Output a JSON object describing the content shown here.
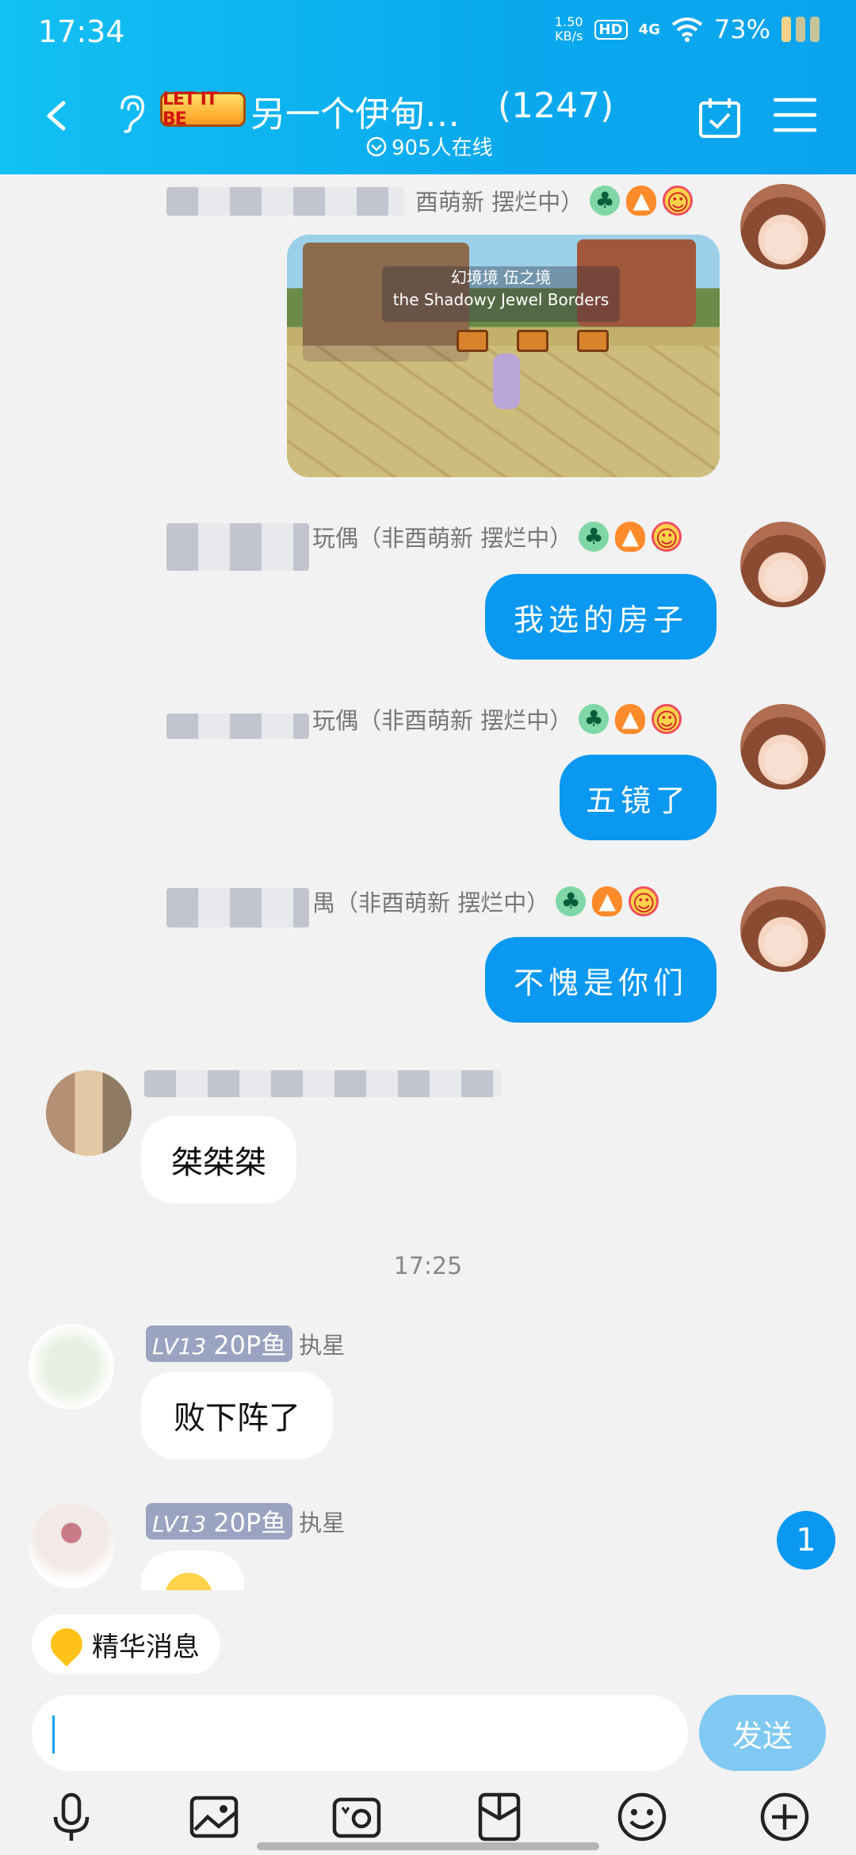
{
  "status_bar": {
    "time": "17:34",
    "speed": "1.50\nKB/s",
    "hd": "HD",
    "network": "4G",
    "battery_percent": "73%"
  },
  "header": {
    "back_icon": "chevron-left-icon",
    "ear_icon": "ear-icon",
    "logo_text": "LET IT BE",
    "title": "另一个伊甸…",
    "member_count": "(1247)",
    "online_text": "905人在线",
    "calendar_icon": "calendar-check-icon",
    "menu_icon": "hamburger-menu-icon"
  },
  "messages": {
    "m1_sender_suffix": "酉萌新 摆烂中）",
    "m1_banner_title": "幻境境 伍之境",
    "m1_banner_sub": "the Shadowy Jewel Borders",
    "m2_sender_suffix": "玩偶（非酉萌新 摆烂中）",
    "m2_text": "我选的房子",
    "m3_sender_suffix": "玩偶（非酉萌新 摆烂中）",
    "m3_text": "五镜了",
    "m4_sender_suffix": "禺（非酉萌新 摆烂中）",
    "m4_text": "不愧是你们",
    "m5_text": "桀桀桀",
    "time_sep": "17:25",
    "m6_level": "LV13",
    "m6_title": "20P鱼",
    "m6_name": "执星",
    "m6_text": "败下阵了",
    "m7_level": "LV13",
    "m7_title": "20P鱼",
    "m7_name": "执星",
    "unread_count": "1"
  },
  "bottom": {
    "essence_label": "精华消息",
    "input_value": "",
    "send_label": "发送"
  },
  "toolbar": {
    "icons": [
      "microphone-icon",
      "image-icon",
      "camera-icon",
      "file-icon",
      "emoji-icon",
      "plus-circle-icon"
    ]
  },
  "colors": {
    "header_blue": "#0aa9ee",
    "bubble_blue": "#0a98f0",
    "send_disabled": "#80c9f3"
  }
}
